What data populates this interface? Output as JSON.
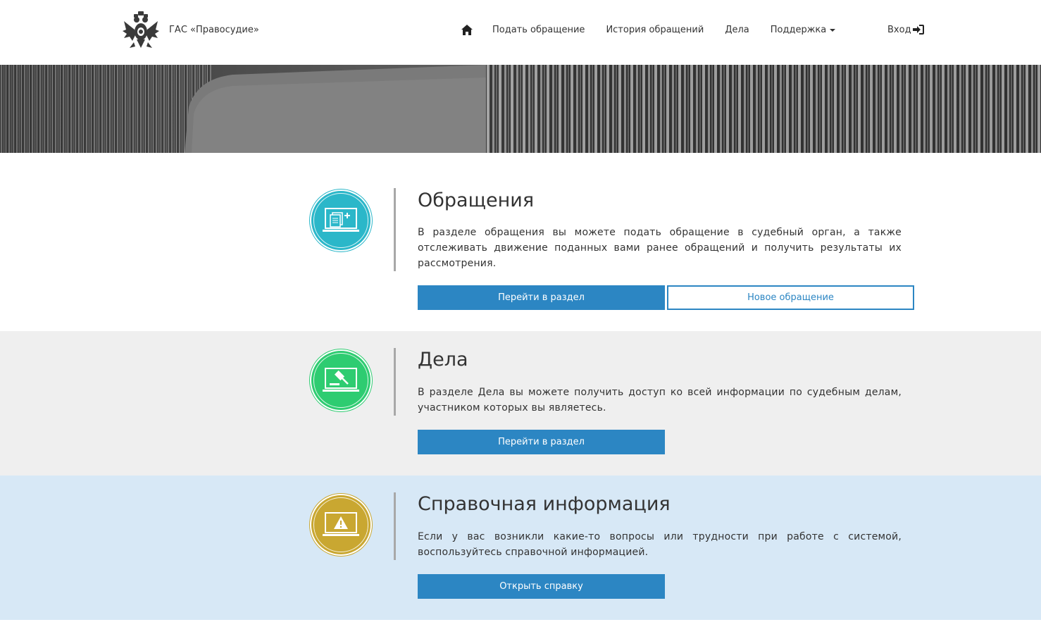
{
  "header": {
    "brand": "ГАС «Правосудие»",
    "nav": {
      "submit": "Подать обращение",
      "history": "История обращений",
      "cases": "Дела",
      "support": "Поддержка"
    },
    "login": "Вход"
  },
  "sections": [
    {
      "title": "Обращения",
      "text": "В разделе обращения вы можете подать обращение в судебный орган, а также отслеживать движение поданных вами ранее обращений и получить результаты их рассмотрения.",
      "primary_button": "Перейти в раздел",
      "secondary_button": "Новое обращение",
      "icon": "document-laptop-icon",
      "color": "#2bb7c9"
    },
    {
      "title": "Дела",
      "text": "В разделе Дела вы можете получить доступ ко всей информации по судебным делам, участником которых вы являетесь.",
      "primary_button": "Перейти в раздел",
      "icon": "gavel-laptop-icon",
      "color": "#2ecc71"
    },
    {
      "title": "Справочная информация",
      "text": "Если у вас возникли какие-то вопросы или трудности при работе с системой, воспользуйтесь справочной информацией.",
      "primary_button": "Открыть справку",
      "icon": "info-laptop-icon",
      "color": "#c9a731"
    }
  ],
  "colors": {
    "accent": "#2c86c3",
    "section2_bg": "#efefef",
    "section3_bg": "#d7e8f6"
  }
}
